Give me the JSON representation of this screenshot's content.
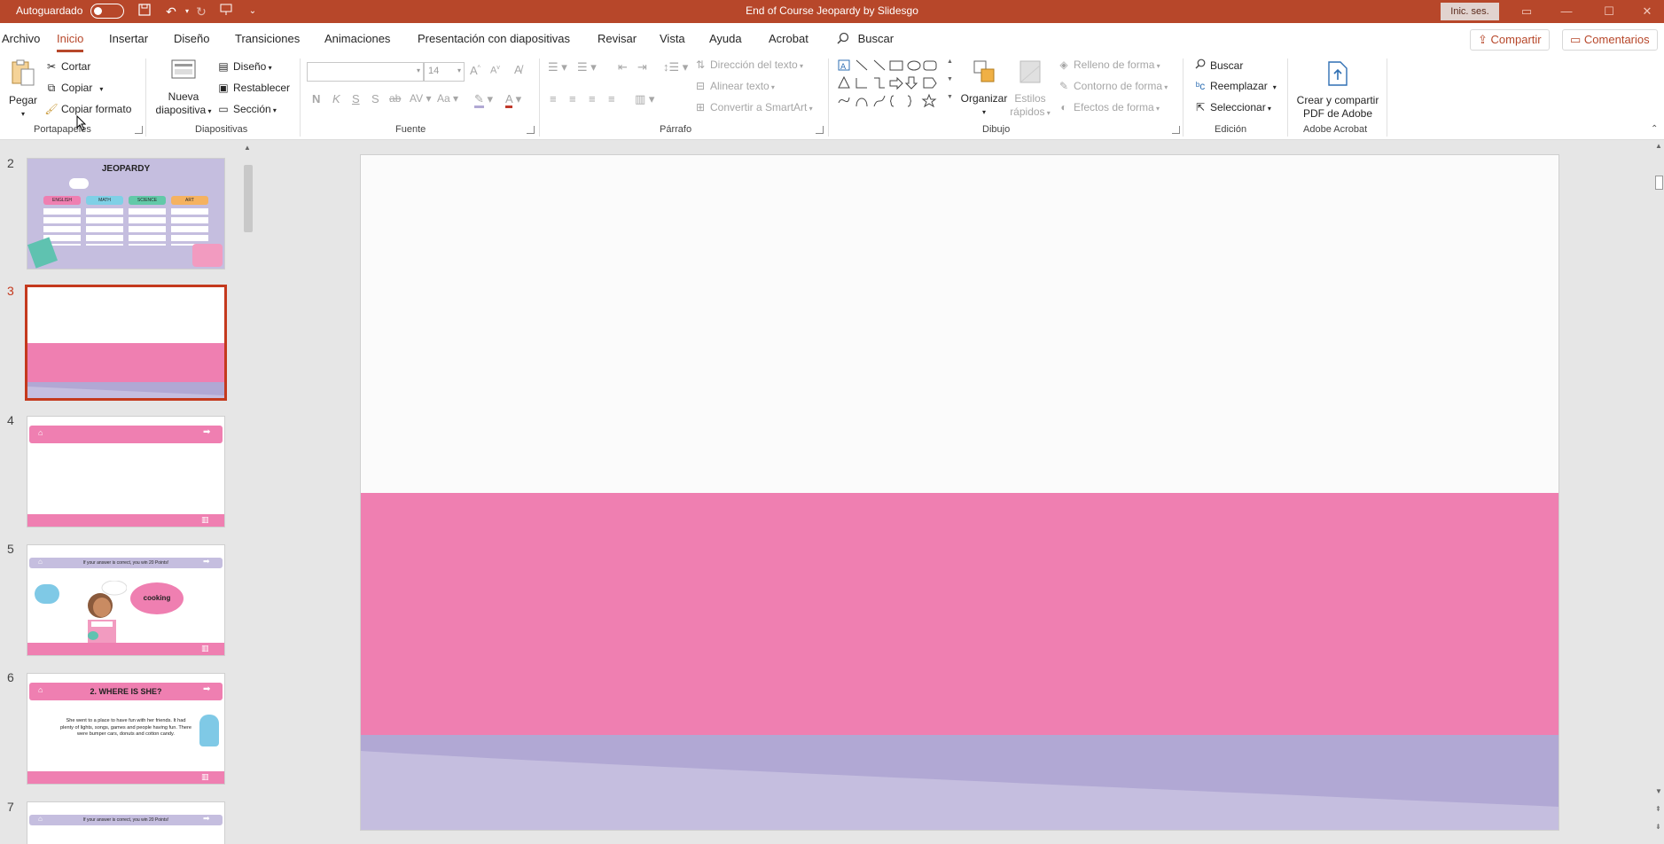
{
  "titlebar": {
    "autosave_label": "Autoguardado",
    "doc_title": "End of Course Jeopardy by Slidesgo",
    "signin_label": "Inic. ses."
  },
  "menu": {
    "tabs": [
      "Archivo",
      "Inicio",
      "Insertar",
      "Diseño",
      "Transiciones",
      "Animaciones",
      "Presentación con diapositivas",
      "Revisar",
      "Vista",
      "Ayuda",
      "Acrobat"
    ],
    "active_tab": "Inicio",
    "search_label": "Buscar",
    "share_label": "Compartir",
    "comments_label": "Comentarios"
  },
  "ribbon": {
    "clipboard": {
      "paste": "Pegar",
      "cut": "Cortar",
      "copy": "Copiar",
      "format_painter": "Copiar formato",
      "group_label": "Portapapeles"
    },
    "slides": {
      "new_slide_line1": "Nueva",
      "new_slide_line2": "diapositiva",
      "layout": "Diseño",
      "reset": "Restablecer",
      "section": "Sección",
      "group_label": "Diapositivas"
    },
    "font": {
      "font_size": "14",
      "group_label": "Fuente"
    },
    "paragraph": {
      "text_direction": "Dirección del texto",
      "align_text": "Alinear texto",
      "smartart": "Convertir a SmartArt",
      "group_label": "Párrafo"
    },
    "drawing": {
      "arrange": "Organizar",
      "quick_styles_line1": "Estilos",
      "quick_styles_line2": "rápidos",
      "shape_fill": "Relleno de forma",
      "shape_outline": "Contorno de forma",
      "shape_effects": "Efectos de forma",
      "group_label": "Dibujo"
    },
    "editing": {
      "find": "Buscar",
      "replace": "Reemplazar",
      "select": "Seleccionar",
      "group_label": "Edición"
    },
    "acrobat": {
      "create_line1": "Crear y compartir",
      "create_line2": "PDF de Adobe",
      "group_label": "Adobe Acrobat"
    }
  },
  "thumbnails": [
    {
      "number": "2",
      "title": "JEOPARDY",
      "categories": [
        "ENGLISH",
        "MATH",
        "SCIENCE",
        "ART"
      ]
    },
    {
      "number": "3",
      "selected": true
    },
    {
      "number": "4"
    },
    {
      "number": "5",
      "banner": "If your answer is correct, you win 20 Points!",
      "bubble": "cooking"
    },
    {
      "number": "6",
      "title": "2. WHERE IS SHE?",
      "body": "She went to a place to have fun with her friends. It had plenty of lights, songs, games and people having fun. There were bumper cars, donuts and cotton candy."
    },
    {
      "number": "7",
      "banner": "If your answer is correct, you win 20 Points!"
    }
  ],
  "colors": {
    "accent": "#b7472a",
    "slide_pink": "#ef7fb1",
    "slide_lavender": "#b1a8d4",
    "slide_lavender_light": "#c5bedf"
  }
}
